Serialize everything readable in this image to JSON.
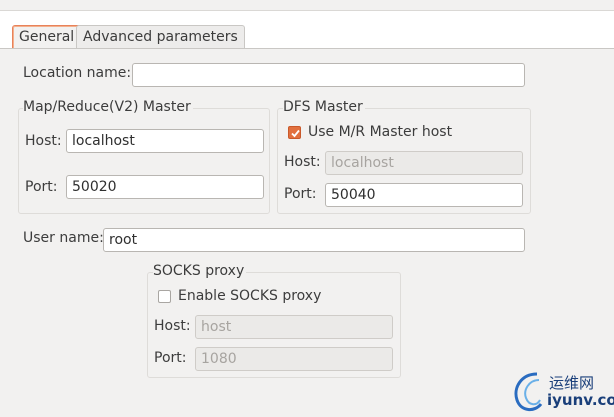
{
  "tabs": {
    "general": "General",
    "advanced": "Advanced parameters"
  },
  "location": {
    "label": "Location name:",
    "value": ""
  },
  "mapreduce": {
    "title": "Map/Reduce(V2) Master",
    "host_label": "Host:",
    "host_value": "localhost",
    "port_label": "Port:",
    "port_value": "50020"
  },
  "dfs": {
    "title": "DFS Master",
    "use_mr_label": "Use M/R Master host",
    "use_mr_checked": true,
    "host_label": "Host:",
    "host_value": "localhost",
    "port_label": "Port:",
    "port_value": "50040"
  },
  "user": {
    "label": "User name:",
    "value": "root"
  },
  "socks": {
    "title": "SOCKS proxy",
    "enable_label": "Enable SOCKS proxy",
    "enable_checked": false,
    "host_label": "Host:",
    "host_value": "host",
    "port_label": "Port:",
    "port_value": "1080"
  },
  "watermark": {
    "line1": "运维网",
    "line2": "iyunv.com"
  },
  "colors": {
    "panel": "#f2f1f0",
    "accent": "#e2703e"
  }
}
